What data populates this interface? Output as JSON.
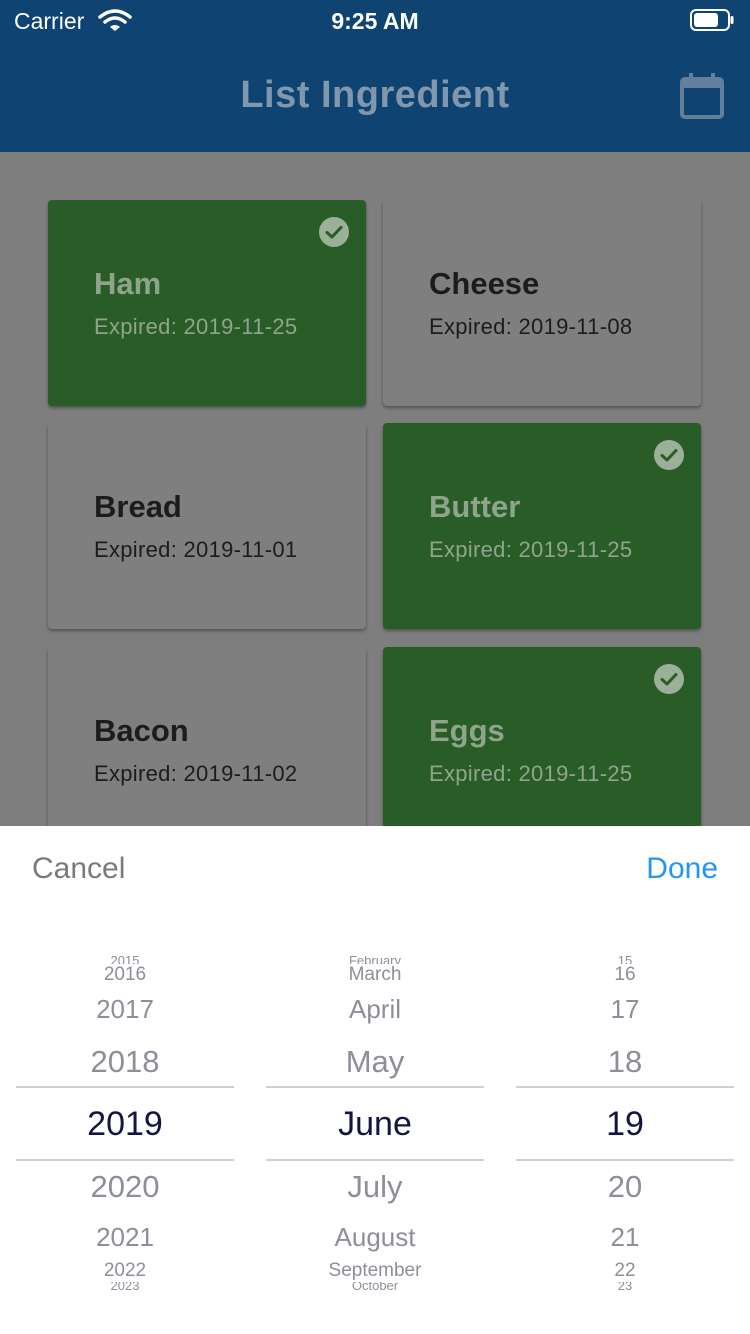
{
  "status_bar": {
    "carrier": "Carrier",
    "time": "9:25 AM"
  },
  "app_bar": {
    "title": "List Ingredient",
    "action_icon": "calendar-icon"
  },
  "ingredients": [
    {
      "name": "Ham",
      "expiry": "Expired: 2019-11-25",
      "selected": true
    },
    {
      "name": "Cheese",
      "expiry": "Expired: 2019-11-08",
      "selected": false
    },
    {
      "name": "Bread",
      "expiry": "Expired: 2019-11-01",
      "selected": false
    },
    {
      "name": "Butter",
      "expiry": "Expired: 2019-11-25",
      "selected": true
    },
    {
      "name": "Bacon",
      "expiry": "Expired: 2019-11-02",
      "selected": false
    },
    {
      "name": "Eggs",
      "expiry": "Expired: 2019-11-25",
      "selected": true
    }
  ],
  "picker": {
    "cancel_label": "Cancel",
    "done_label": "Done",
    "year": {
      "above": [
        "2015",
        "2016",
        "2017",
        "2018"
      ],
      "selected": "2019",
      "below": [
        "2020",
        "2021",
        "2022",
        "2023"
      ]
    },
    "month": {
      "above": [
        "February",
        "March",
        "April",
        "May"
      ],
      "selected": "June",
      "below": [
        "July",
        "August",
        "September",
        "October"
      ]
    },
    "day": {
      "above": [
        "15",
        "16",
        "17",
        "18"
      ],
      "selected": "19",
      "below": [
        "20",
        "21",
        "22",
        "23"
      ]
    }
  },
  "colors": {
    "app_bar": "#0f4472",
    "selected_card": "#2a5c28",
    "done_blue": "#2196f3",
    "picker_selected_text": "#141440"
  }
}
